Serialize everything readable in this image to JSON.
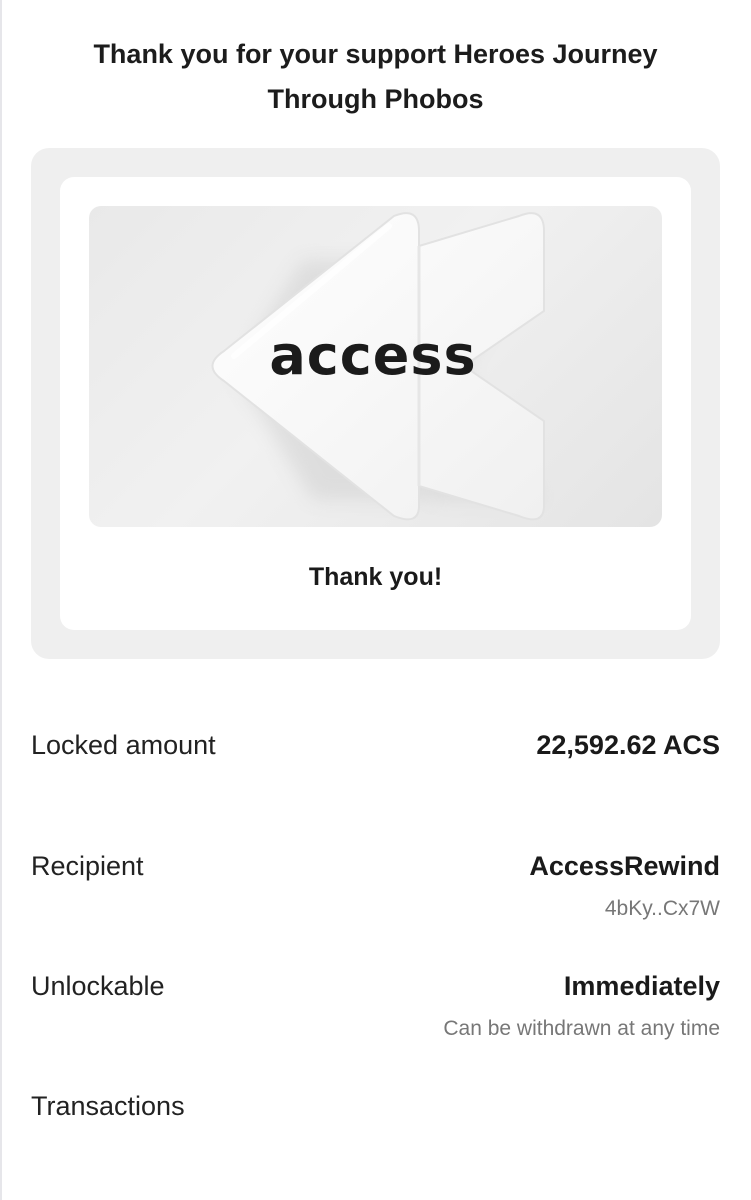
{
  "header": {
    "prefix": "Thank you for your support ",
    "project": "Heroes Journey Through Phobos"
  },
  "card": {
    "logo_text": "access",
    "caption": "Thank you!"
  },
  "details": {
    "locked_amount": {
      "label": "Locked amount",
      "value": "22,592.62 ACS"
    },
    "recipient": {
      "label": "Recipient",
      "value": "AccessRewind",
      "sub": "4bKy..Cx7W"
    },
    "unlockable": {
      "label": "Unlockable",
      "value": "Immediately",
      "sub": "Can be withdrawn at any time"
    },
    "transactions": {
      "label": "Transactions"
    }
  },
  "colors": {
    "background": "#ffffff",
    "card_outer": "#efefef",
    "card_inner": "#ffffff",
    "muted_text": "#777777"
  },
  "icons": [
    "rewind-logo-icon"
  ]
}
